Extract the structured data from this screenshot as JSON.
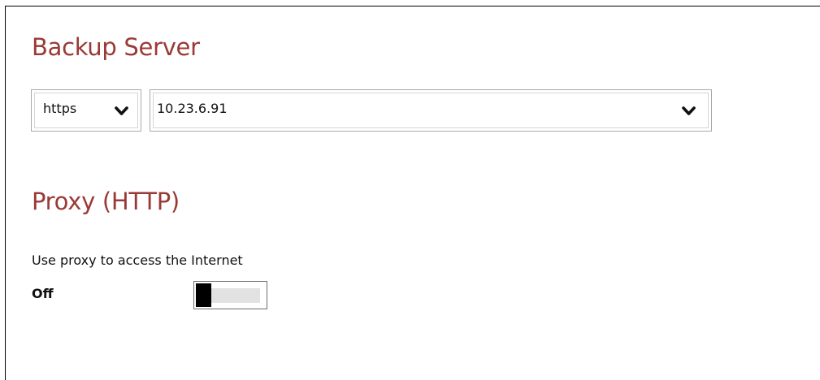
{
  "backup_server": {
    "title": "Backup Server",
    "protocol": {
      "value": "https"
    },
    "server": {
      "value": "10.23.6.91"
    }
  },
  "proxy": {
    "title": "Proxy (HTTP)",
    "use_proxy_label": "Use proxy to access the Internet",
    "toggle": {
      "state_label": "Off",
      "on": false
    }
  },
  "colors": {
    "title_accent": "#9a3a36",
    "toggle_knob": "#000000",
    "toggle_track": "#e2e2e2"
  },
  "icons": {
    "dropdown": "chevron-down-icon"
  }
}
